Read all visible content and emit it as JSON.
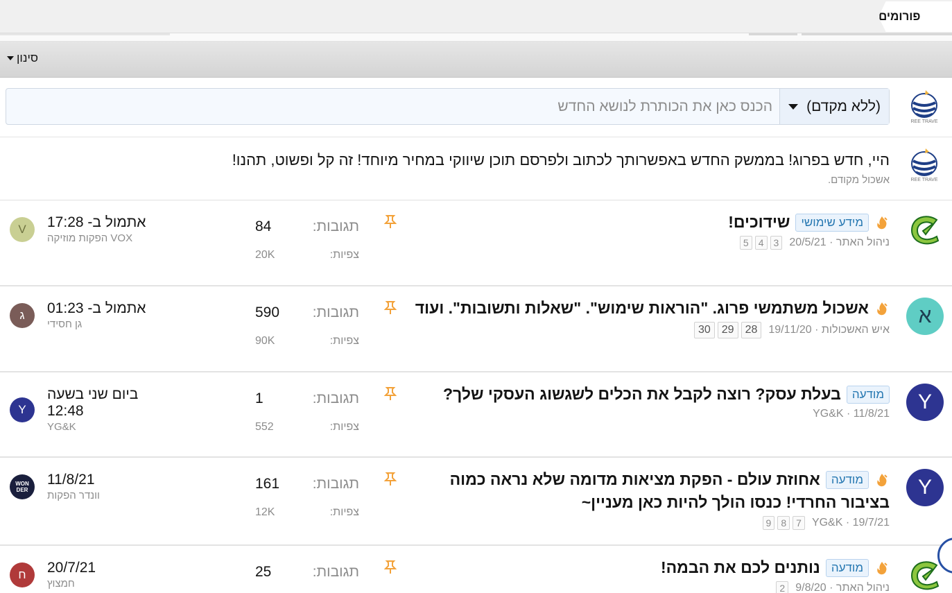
{
  "tabs": {
    "forums": "פורומים"
  },
  "filter": {
    "label": "סינון"
  },
  "new_thread": {
    "prefix": "(ללא מקדם)",
    "placeholder": "הכנס כאן את הכותרת לנושא החדש"
  },
  "notice": {
    "message": "היי, חדש בפרוג! בממשק החדש באפשרותך לכתוב ולפרסם תוכן שיווקי במחיר מיוחד! זה קל ופשוט, תהנו!",
    "author": "אשכול מקודם."
  },
  "labels": {
    "replies": "תגובות:",
    "views": "צפיות:"
  },
  "threads": [
    {
      "avatar_style": "logo-green",
      "prefix": "מידע שימושי",
      "title": "שידוכים!",
      "title2": "",
      "author": "ניהול האתר",
      "date": "20/5/21",
      "pages": [
        "3",
        "4",
        "5"
      ],
      "replies": "84",
      "views": "20K",
      "last_time": "אתמול ב- 17:28",
      "last_user": "VOX הפקות מוזיקה",
      "last_avatar": "V",
      "last_avatar_color": "#c9cf93"
    },
    {
      "avatar_style": "letter",
      "avatar_letter": "א",
      "avatar_color": "#5fcdc4",
      "prefix": "",
      "title": "אשכול משתמשי פרוג. \"הוראות שימוש\". \"שאלות ותשובות\". ועוד",
      "title2": "",
      "author": "איש האשכולות",
      "date": "19/11/20",
      "pages": [
        "28",
        "29",
        "30"
      ],
      "replies": "590",
      "views": "90K",
      "last_time": "אתמול ב- 01:23",
      "last_user": "גן חסידי",
      "last_avatar": "ג",
      "last_avatar_color": "#7a5c58"
    },
    {
      "avatar_style": "letter",
      "avatar_letter": "Y",
      "avatar_color": "#2d3491",
      "prefix": "מודעה",
      "title": "בעלת עסק? רוצה לקבל את הכלים לשגשוג העסקי שלך?",
      "title2": "",
      "author": "YG&K",
      "date": "11/8/21",
      "pages": [],
      "replies": "1",
      "views": "552",
      "last_time": "ביום שני בשעה 12:48",
      "last_user": "YG&K",
      "last_avatar": "Y",
      "last_avatar_color": "#2d3491"
    },
    {
      "avatar_style": "letter",
      "avatar_letter": "Y",
      "avatar_color": "#2d3491",
      "prefix": "מודעה",
      "title": "אחוזת עולם - הפקת מציאות מדומה שלא נראה כמוה",
      "title2": "בציבור החרדי! כנסו הולך להיות כאן מעניין~",
      "author": "YG&K",
      "date": "19/7/21",
      "pages": [
        "7",
        "8",
        "9"
      ],
      "replies": "161",
      "views": "12K",
      "last_time": "11/8/21",
      "last_user": "וונדר הפקות",
      "last_avatar": "WON DER",
      "last_avatar_color": "#1a1f3d"
    },
    {
      "avatar_style": "logo-green",
      "prefix": "מודעה",
      "title": "נותנים לכם את הבמה!",
      "title2": "",
      "author": "ניהול האתר",
      "date": "9/8/20",
      "pages": [
        "2"
      ],
      "replies": "25",
      "views": "",
      "last_time": "20/7/21",
      "last_user": "חמצוץ",
      "last_avatar": "ח",
      "last_avatar_color": "#b03a3a"
    }
  ],
  "colors": {
    "accent": "#2577b1",
    "pin": "#f3a23a",
    "tag_bg": "#eaf3fc"
  },
  "icons": {
    "pin": "pin-icon",
    "hot": "hot-thread-icon",
    "filter_caret": "chevron-down-icon"
  }
}
